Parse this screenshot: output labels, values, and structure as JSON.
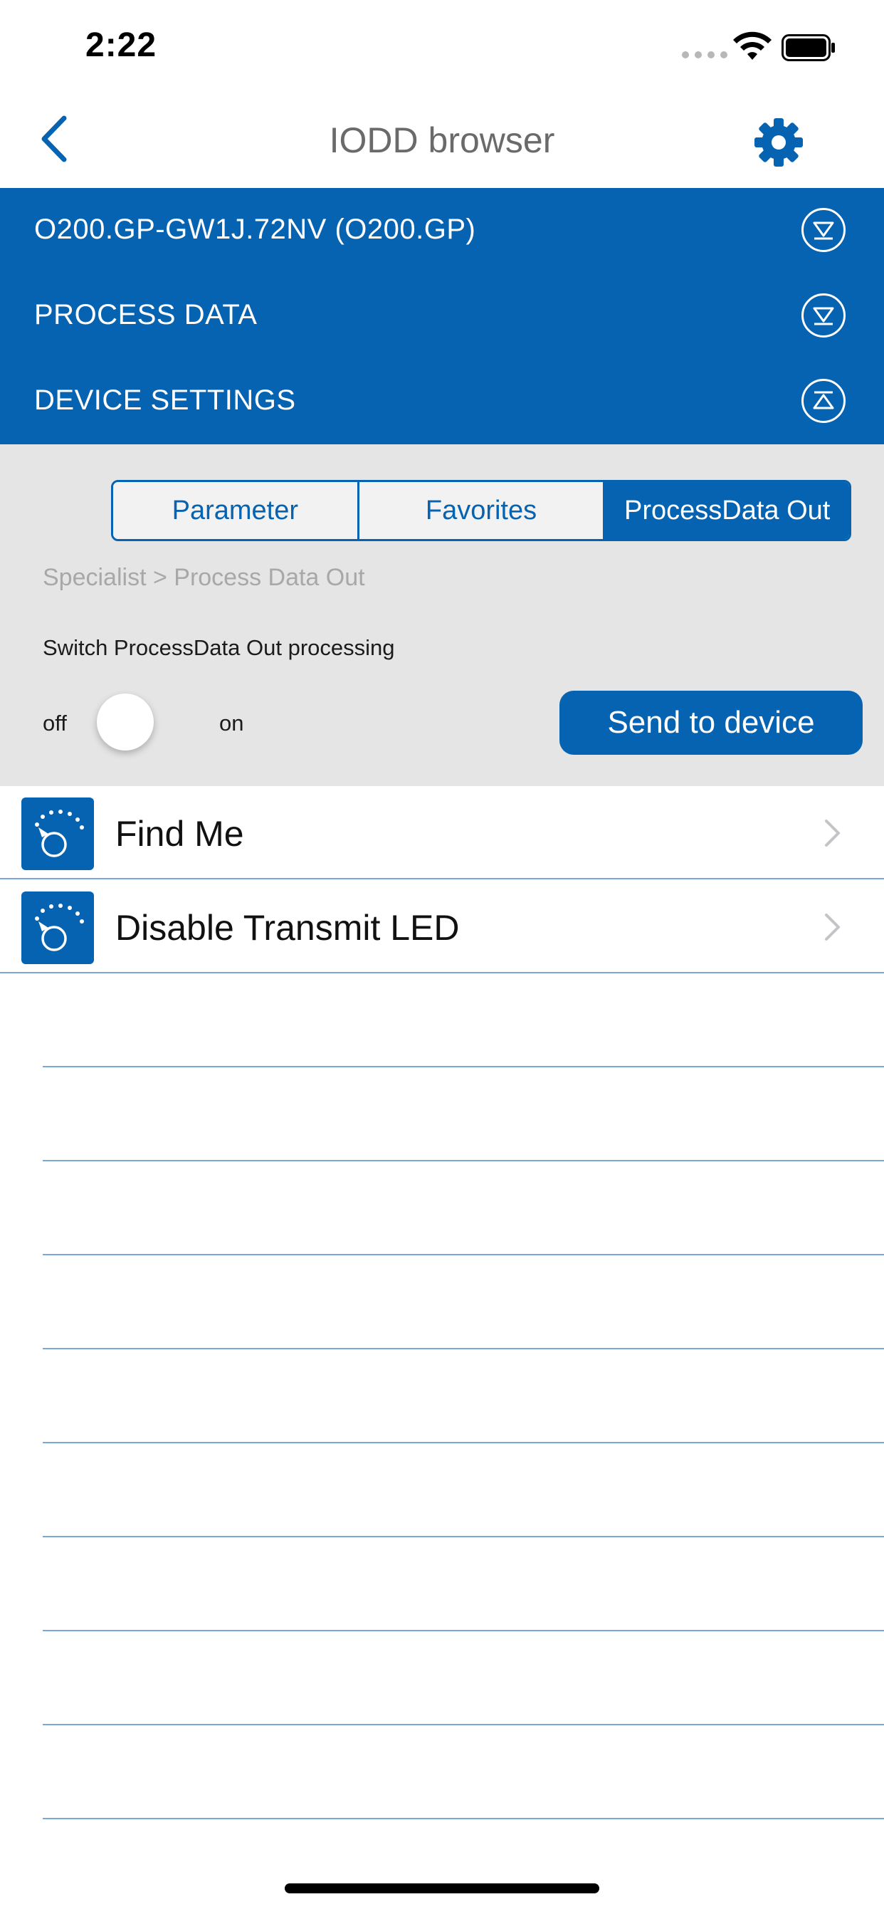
{
  "status_bar": {
    "time": "2:22"
  },
  "nav": {
    "title": "IODD browser"
  },
  "header_sections": [
    {
      "label": "O200.GP-GW1J.72NV (O200.GP)",
      "state": "collapsed"
    },
    {
      "label": "PROCESS DATA",
      "state": "collapsed"
    },
    {
      "label": "DEVICE SETTINGS",
      "state": "expanded"
    }
  ],
  "tabs": [
    {
      "label": "Parameter",
      "active": false
    },
    {
      "label": "Favorites",
      "active": false
    },
    {
      "label": "ProcessData Out",
      "active": true
    }
  ],
  "breadcrumb": "Specialist > Process Data Out",
  "switch": {
    "label": "Switch ProcessData Out processing",
    "off_label": "off",
    "on_label": "on",
    "value": "off"
  },
  "send_button": "Send to device",
  "list_items": [
    {
      "label": "Find Me",
      "icon": "dial-icon"
    },
    {
      "label": "Disable Transmit LED",
      "icon": "dial-icon"
    }
  ],
  "colors": {
    "accent": "#0563b1",
    "gray_bg": "#e5e5e5",
    "separator": "#7aa7d6"
  }
}
